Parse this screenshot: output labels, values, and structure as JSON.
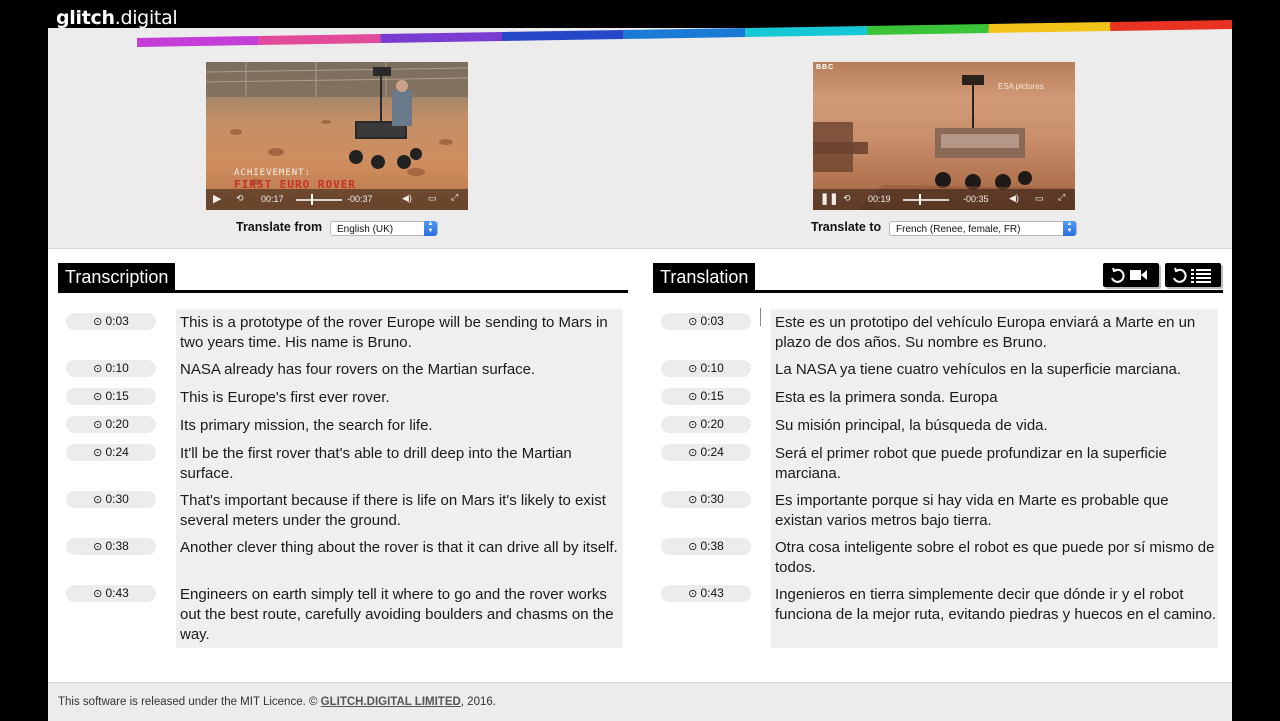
{
  "brand": {
    "name_bold": "glitch",
    "name_rest": ".digital"
  },
  "colors": {
    "stripe": [
      "#c33dd6",
      "#e24a9a",
      "#7a3cd1",
      "#2747c9",
      "#1a7ad6",
      "#16c8d6",
      "#3bc43a",
      "#f2c319",
      "#e83323"
    ]
  },
  "video_left": {
    "caption_top": "ACHIEVEMENT:",
    "caption_bottom": "FIRST EURO ROVER",
    "current_time": "00:17",
    "remaining_time": "-00:37",
    "progress": 0.32
  },
  "video_right": {
    "channel_logo": "BBC",
    "watermark": "ESA pictures",
    "current_time": "00:19",
    "remaining_time": "-00:35",
    "progress": 0.35
  },
  "translate_from": {
    "label": "Translate from",
    "value": "English (UK)"
  },
  "translate_to": {
    "label": "Translate to",
    "value": "French (Renee, female, FR)"
  },
  "transcription": {
    "title": "Transcription",
    "rows": [
      {
        "time": "0:03",
        "text": "This is a prototype of the rover Europe will be sending to Mars in two years time. His name is Bruno."
      },
      {
        "time": "0:10",
        "text": "NASA already has four rovers on the Martian surface."
      },
      {
        "time": "0:15",
        "text": "This is Europe's first ever rover."
      },
      {
        "time": "0:20",
        "text": "Its primary mission, the search for life."
      },
      {
        "time": "0:24",
        "text": "It'll be the first rover that's able to drill deep into the Martian surface."
      },
      {
        "time": "0:30",
        "text": "That's important because if there is life on Mars it's likely to exist several meters under the ground."
      },
      {
        "time": "0:38",
        "text": "Another clever thing about the rover is that it can drive all by itself."
      },
      {
        "time": "0:43",
        "text": "Engineers on earth simply tell it where to go and the rover works out the best route, carefully avoiding boulders and chasms on the way."
      }
    ]
  },
  "translation": {
    "title": "Translation",
    "buttons": [
      {
        "icons": [
          "refresh-icon",
          "video-camera-icon"
        ]
      },
      {
        "icons": [
          "refresh-icon",
          "list-icon"
        ]
      }
    ],
    "rows": [
      {
        "time": "0:03",
        "text": "Este es un prototipo del vehículo Europa enviará a Marte en un plazo de dos años.  Su nombre es Bruno."
      },
      {
        "time": "0:10",
        "text": "La NASA ya tiene cuatro vehículos en la superficie marciana."
      },
      {
        "time": "0:15",
        "text": "Esta es la primera sonda. Europa"
      },
      {
        "time": "0:20",
        "text": "Su misión principal, la búsqueda de vida."
      },
      {
        "time": "0:24",
        "text": "Será el primer robot que puede profundizar en la superficie marciana."
      },
      {
        "time": "0:30",
        "text": "Es importante porque si hay vida en Marte es probable que existan varios metros bajo tierra."
      },
      {
        "time": "0:38",
        "text": "Otra cosa inteligente sobre el robot es que puede por sí mismo de todos."
      },
      {
        "time": "0:43",
        "text": "Ingenieros en tierra simplemente decir que dónde ir y el robot funciona de la mejor ruta, evitando piedras y huecos en el camino."
      }
    ]
  },
  "footer": {
    "prefix": "This software is released under the MIT Licence. © ",
    "brand": "GLITCH.DIGITAL LIMITED",
    "suffix": ", 2016."
  }
}
